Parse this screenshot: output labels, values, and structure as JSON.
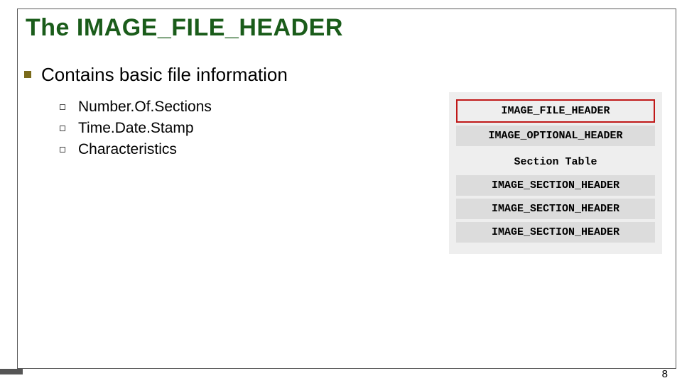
{
  "title": "The IMAGE_FILE_HEADER",
  "main_bullet": "Contains basic file information",
  "sub_bullets": {
    "b0": "Number.Of.Sections",
    "b1": "Time.Date.Stamp",
    "b2": "Characteristics"
  },
  "diagram": {
    "box0": "IMAGE_FILE_HEADER",
    "box1": "IMAGE_OPTIONAL_HEADER",
    "plain": "Section Table",
    "box2": "IMAGE_SECTION_HEADER",
    "box3": "IMAGE_SECTION_HEADER",
    "box4": "IMAGE_SECTION_HEADER"
  },
  "page_number": "8"
}
